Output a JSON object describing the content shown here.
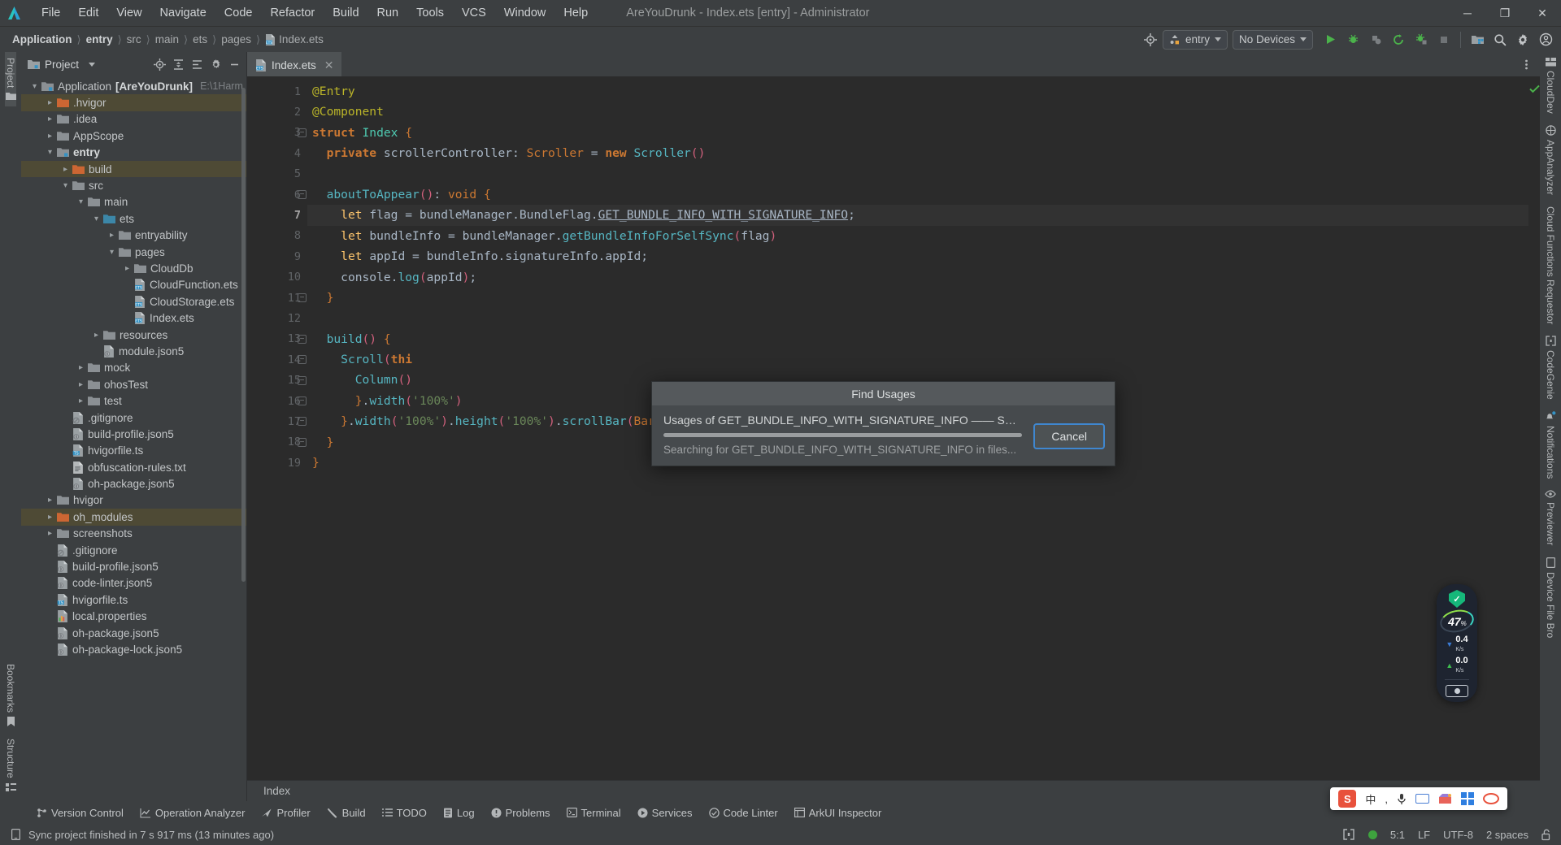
{
  "window": {
    "title": "AreYouDrunk - Index.ets [entry] - Administrator",
    "minimize": "─",
    "maximize": "❐",
    "close": "✕"
  },
  "menubar": {
    "items": [
      "File",
      "Edit",
      "View",
      "Navigate",
      "Code",
      "Refactor",
      "Build",
      "Run",
      "Tools",
      "VCS",
      "Window",
      "Help"
    ]
  },
  "breadcrumb": {
    "items": [
      "Application",
      "entry",
      "src",
      "main",
      "ets",
      "pages",
      "Index.ets"
    ]
  },
  "toolbar": {
    "target_device_button": "target-device-icon",
    "run_config": "entry",
    "devices": "No Devices",
    "icons": [
      "run-icon",
      "debug-icon",
      "attach-debugger-icon",
      "profiler-run-icon",
      "run-coverage-icon",
      "stop-icon",
      "device-manager-icon",
      "search-everywhere-icon",
      "settings-icon",
      "account-icon"
    ]
  },
  "left_rail": {
    "top": [
      {
        "label": "Project",
        "icon": "folder-icon",
        "active": true
      }
    ],
    "bottom": [
      {
        "label": "Bookmarks",
        "icon": "bookmark-icon"
      },
      {
        "label": "Structure",
        "icon": "structure-icon"
      }
    ]
  },
  "right_rail": {
    "items": [
      {
        "label": "CloudDev",
        "icon": "clouddev-icon"
      },
      {
        "label": "AppAnalyzer",
        "icon": "appanalyzer-icon"
      },
      {
        "label": "Cloud Functions Requestor",
        "icon": "cloud-functions-icon"
      },
      {
        "label": "CodeGenie",
        "icon": "codegenie-icon"
      },
      {
        "label": "Notifications",
        "icon": "notifications-bell-icon"
      },
      {
        "label": "Previewer",
        "icon": "eye-icon"
      },
      {
        "label": "Device File Bro",
        "icon": "device-file-browser-icon"
      }
    ]
  },
  "project_panel": {
    "title": "Project",
    "actions": [
      "locate-icon",
      "expand-all-icon",
      "collapse-all-icon",
      "settings-icon",
      "hide-icon"
    ],
    "tree": [
      {
        "depth": 0,
        "arrow": "⌄",
        "icon": "module-folder",
        "label": "Application",
        "bold_label": "[AreYouDrunk]",
        "path": "E:\\1Harm",
        "state": "normal"
      },
      {
        "depth": 1,
        "arrow": "›",
        "icon": "folder-orange",
        "label": ".hvigor",
        "state": "excluded"
      },
      {
        "depth": 1,
        "arrow": "›",
        "icon": "folder",
        "label": ".idea",
        "state": "normal"
      },
      {
        "depth": 1,
        "arrow": "›",
        "icon": "folder",
        "label": "AppScope",
        "state": "normal"
      },
      {
        "depth": 1,
        "arrow": "⌄",
        "icon": "module-folder",
        "label": "entry",
        "bold": true,
        "state": "normal"
      },
      {
        "depth": 2,
        "arrow": "›",
        "icon": "folder-orange",
        "label": "build",
        "state": "excluded"
      },
      {
        "depth": 2,
        "arrow": "⌄",
        "icon": "folder",
        "label": "src",
        "state": "normal"
      },
      {
        "depth": 3,
        "arrow": "⌄",
        "icon": "folder",
        "label": "main",
        "state": "normal"
      },
      {
        "depth": 4,
        "arrow": "⌄",
        "icon": "folder-source",
        "label": "ets",
        "state": "normal"
      },
      {
        "depth": 5,
        "arrow": "›",
        "icon": "folder",
        "label": "entryability",
        "state": "normal"
      },
      {
        "depth": 5,
        "arrow": "⌄",
        "icon": "folder",
        "label": "pages",
        "state": "normal"
      },
      {
        "depth": 6,
        "arrow": "›",
        "icon": "folder",
        "label": "CloudDb",
        "state": "normal"
      },
      {
        "depth": 6,
        "arrow": "",
        "icon": "ets-file",
        "label": "CloudFunction.ets",
        "state": "normal"
      },
      {
        "depth": 6,
        "arrow": "",
        "icon": "ets-file",
        "label": "CloudStorage.ets",
        "state": "normal"
      },
      {
        "depth": 6,
        "arrow": "",
        "icon": "ets-file",
        "label": "Index.ets",
        "state": "normal"
      },
      {
        "depth": 4,
        "arrow": "›",
        "icon": "folder",
        "label": "resources",
        "state": "normal"
      },
      {
        "depth": 4,
        "arrow": "",
        "icon": "json-file",
        "label": "module.json5",
        "state": "normal"
      },
      {
        "depth": 3,
        "arrow": "›",
        "icon": "folder",
        "label": "mock",
        "state": "normal"
      },
      {
        "depth": 3,
        "arrow": "›",
        "icon": "folder",
        "label": "ohosTest",
        "state": "normal"
      },
      {
        "depth": 3,
        "arrow": "›",
        "icon": "folder",
        "label": "test",
        "state": "normal"
      },
      {
        "depth": 2,
        "arrow": "",
        "icon": "gitignore-file",
        "label": ".gitignore",
        "state": "normal"
      },
      {
        "depth": 2,
        "arrow": "",
        "icon": "json-file",
        "label": "build-profile.json5",
        "state": "normal"
      },
      {
        "depth": 2,
        "arrow": "",
        "icon": "ts-file",
        "label": "hvigorfile.ts",
        "state": "normal"
      },
      {
        "depth": 2,
        "arrow": "",
        "icon": "txt-file",
        "label": "obfuscation-rules.txt",
        "state": "normal"
      },
      {
        "depth": 2,
        "arrow": "",
        "icon": "json-file",
        "label": "oh-package.json5",
        "state": "normal"
      },
      {
        "depth": 1,
        "arrow": "›",
        "icon": "folder",
        "label": "hvigor",
        "state": "normal"
      },
      {
        "depth": 1,
        "arrow": "›",
        "icon": "folder-orange",
        "label": "oh_modules",
        "state": "excluded"
      },
      {
        "depth": 1,
        "arrow": "›",
        "icon": "folder",
        "label": "screenshots",
        "state": "normal"
      },
      {
        "depth": 1,
        "arrow": "",
        "icon": "gitignore-file",
        "label": ".gitignore",
        "state": "normal"
      },
      {
        "depth": 1,
        "arrow": "",
        "icon": "json-file",
        "label": "build-profile.json5",
        "state": "normal"
      },
      {
        "depth": 1,
        "arrow": "",
        "icon": "json-file",
        "label": "code-linter.json5",
        "state": "normal"
      },
      {
        "depth": 1,
        "arrow": "",
        "icon": "ts-file",
        "label": "hvigorfile.ts",
        "state": "normal"
      },
      {
        "depth": 1,
        "arrow": "",
        "icon": "properties-file",
        "label": "local.properties",
        "state": "normal"
      },
      {
        "depth": 1,
        "arrow": "",
        "icon": "json-file",
        "label": "oh-package.json5",
        "state": "normal"
      },
      {
        "depth": 1,
        "arrow": "",
        "icon": "json-file",
        "label": "oh-package-lock.json5",
        "state": "normal"
      }
    ]
  },
  "editor": {
    "tab": {
      "label": "Index.ets",
      "icon": "ets-file",
      "close": "✕"
    },
    "more_actions": "more-vertical-icon",
    "inspection_ok": "check-icon",
    "current_line": 7,
    "line_numbers": [
      1,
      2,
      3,
      4,
      5,
      6,
      7,
      8,
      9,
      10,
      11,
      12,
      13,
      14,
      15,
      16,
      17,
      18,
      19
    ],
    "code_lines": [
      {
        "n": 1,
        "html": "<span class=\"dec\">@Entry</span>"
      },
      {
        "n": 2,
        "html": "<span class=\"dec\">@Component</span>"
      },
      {
        "n": 3,
        "html": "<span class=\"k\">struct</span> <span class=\"teal\">Index</span> <span class=\"brc\">{</span>"
      },
      {
        "n": 4,
        "html": "  <span class=\"k\">private</span> <span class=\"id\">scrollerController</span><span class=\"id\">:</span> <span class=\"orng\">Scroller</span> <span class=\"id\">=</span> <span class=\"k\">new</span> <span class=\"fn\">Scroller</span><span class=\"par\">()</span>"
      },
      {
        "n": 5,
        "html": ""
      },
      {
        "n": 6,
        "html": "  <span class=\"fn\">aboutToAppear</span><span class=\"par\">()</span><span class=\"id\">:</span> <span class=\"orng\">void</span> <span class=\"brc\">{</span>"
      },
      {
        "n": 7,
        "html": "    <span class=\"fn2\">let</span> <span class=\"id\">flag</span> <span class=\"id\">=</span> <span class=\"id\">bundleManager</span>.<span class=\"id\">BundleFlag</span>.<span class=\"lnk\">GET_BUNDLE_INFO_WITH_SIGNATURE_INFO</span><span class=\"id\">;</span>"
      },
      {
        "n": 8,
        "html": "    <span class=\"fn2\">let</span> <span class=\"id\">bundleInfo</span> <span class=\"id\">=</span> <span class=\"id\">bundleManager</span>.<span class=\"fn\">getBundleInfoForSelfSync</span><span class=\"par\">(</span><span class=\"id\">flag</span><span class=\"par\">)</span>"
      },
      {
        "n": 9,
        "html": "    <span class=\"fn2\">let</span> <span class=\"id\">appId</span> <span class=\"id\">=</span> <span class=\"id\">bundleInfo</span>.<span class=\"id\">signatureInfo</span>.<span class=\"id\">appId</span><span class=\"id\">;</span>"
      },
      {
        "n": 10,
        "html": "    <span class=\"id\">console</span>.<span class=\"fn\">log</span><span class=\"par\">(</span><span class=\"id\">appId</span><span class=\"par\">)</span><span class=\"id\">;</span>"
      },
      {
        "n": 11,
        "html": "  <span class=\"brc\">}</span>"
      },
      {
        "n": 12,
        "html": ""
      },
      {
        "n": 13,
        "html": "  <span class=\"fn\">build</span><span class=\"par\">()</span> <span class=\"brc\">{</span>"
      },
      {
        "n": 14,
        "html": "    <span class=\"fn\">Scroll</span><span class=\"par\">(</span><span class=\"k\">thi</span>"
      },
      {
        "n": 15,
        "html": "      <span class=\"fn\">Column</span><span class=\"par\">()</span>"
      },
      {
        "n": 16,
        "html": "      <span class=\"brc\">}</span>.<span class=\"fn\">width</span><span class=\"par\">(</span><span class=\"str\">'100%'</span><span class=\"par\">)</span>"
      },
      {
        "n": 17,
        "html": "    <span class=\"brc\">}</span>.<span class=\"fn\">width</span><span class=\"par\">(</span><span class=\"str\">'100%'</span><span class=\"par\">)</span>.<span class=\"fn\">height</span><span class=\"par\">(</span><span class=\"str\">'100%'</span><span class=\"par\">)</span>.<span class=\"fn\">scrollBar</span><span class=\"par\">(</span><span class=\"orng\">BarState</span>.<span class=\"id\">Off</span><span class=\"par\">)</span>"
      },
      {
        "n": 18,
        "html": "  <span class=\"brc\">}</span>"
      },
      {
        "n": 19,
        "html": "<span class=\"brc\">}</span>"
      }
    ]
  },
  "dialog": {
    "title": "Find Usages",
    "line1": "Usages of GET_BUNDLE_INFO_WITH_SIGNATURE_INFO —— Searchin...",
    "line2": "Searching for GET_BUNDLE_INFO_WITH_SIGNATURE_INFO in files...",
    "cancel": "Cancel",
    "progress_pct": 100
  },
  "bottom": {
    "file_breadcrumb": "Index",
    "tool_windows": [
      {
        "label": "Version Control",
        "icon": "branch-icon"
      },
      {
        "label": "Operation Analyzer",
        "icon": "chart-icon"
      },
      {
        "label": "Profiler",
        "icon": "profiler-icon"
      },
      {
        "label": "Build",
        "icon": "hammer-icon"
      },
      {
        "label": "TODO",
        "icon": "list-icon"
      },
      {
        "label": "Log",
        "icon": "log-icon"
      },
      {
        "label": "Problems",
        "icon": "warning-icon"
      },
      {
        "label": "Terminal",
        "icon": "terminal-icon"
      },
      {
        "label": "Services",
        "icon": "services-icon"
      },
      {
        "label": "Code Linter",
        "icon": "linter-icon"
      },
      {
        "label": "ArkUI Inspector",
        "icon": "inspector-icon"
      }
    ],
    "status_icon": "device-icon",
    "status_message": "Sync project finished in 7 s 917 ms (13 minutes ago)",
    "right": {
      "codegenie_icon": "codegenie-icon",
      "indicator": "green-dot",
      "caret_position": "5:1",
      "line_separator": "LF",
      "encoding": "UTF-8",
      "indent": "2 spaces",
      "lock": "unlocked-icon"
    }
  },
  "perf_widget": {
    "shield": "shield-check-icon",
    "cpu_percent": "47",
    "cpu_unit": "%",
    "download_rate": "0.4",
    "download_unit": "K/s",
    "upload_rate": "0.0",
    "upload_unit": "K/s",
    "screenshot": "camera-icon"
  },
  "ime_bar": {
    "logo": "sogou-logo",
    "mode": "中",
    "items": [
      "punctuation-icon",
      "microphone-icon",
      "keyboard-icon",
      "toolbox-icon",
      "apps-icon",
      "skin-icon"
    ]
  },
  "colors": {
    "accent_blue": "#3f87d0",
    "bg_panel": "#3c3f41",
    "bg_editor": "#2b2b2b",
    "selection_excluded": "#4e4a35",
    "green": "#3ea33e",
    "orange_folder": "#cc6633"
  }
}
